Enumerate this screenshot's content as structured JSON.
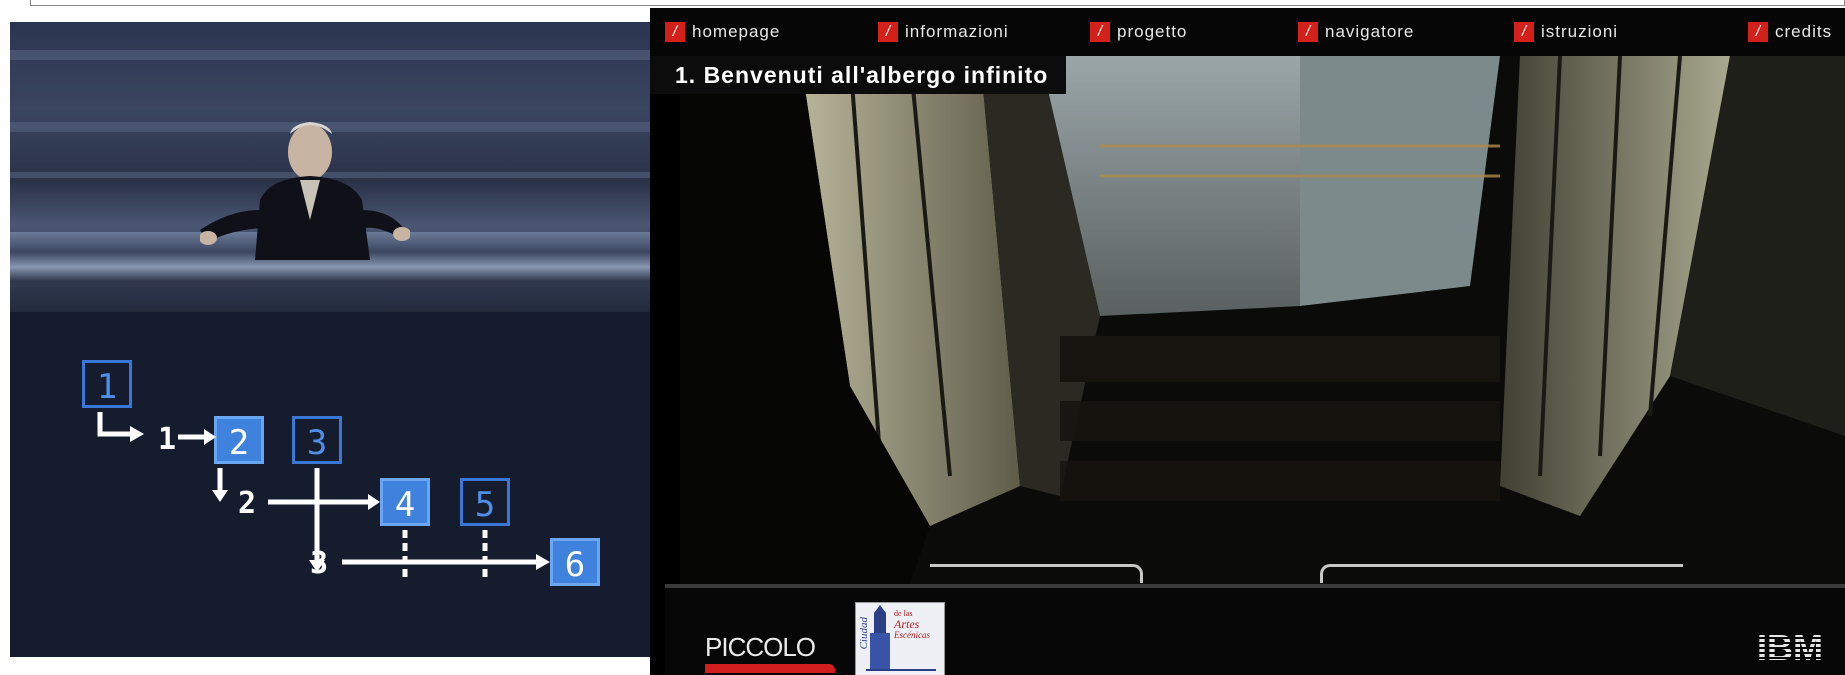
{
  "nav": {
    "items": [
      {
        "label": "homepage",
        "icon": "slash-icon"
      },
      {
        "label": "informazioni",
        "icon": "slash-icon"
      },
      {
        "label": "progetto",
        "icon": "slash-icon"
      },
      {
        "label": "navigatore",
        "icon": "slash-icon"
      },
      {
        "label": "istruzioni",
        "icon": "slash-icon"
      },
      {
        "label": "credits",
        "icon": "slash-icon"
      }
    ],
    "accent_color": "#d4201a"
  },
  "video": {
    "title": "1. Benvenuti all'albergo infinito"
  },
  "diagram": {
    "boxes": [
      "1",
      "2",
      "3",
      "4",
      "5",
      "6"
    ],
    "steps": [
      "1",
      "2",
      "3"
    ]
  },
  "footer": {
    "logos": {
      "piccolo": "PICCOLO",
      "ciudad_line1": "de las",
      "ciudad_line2": "Artes",
      "ciudad_line3": "Escénicas",
      "ciudad_vertical": "Ciudad",
      "ibm": "IBM"
    }
  }
}
